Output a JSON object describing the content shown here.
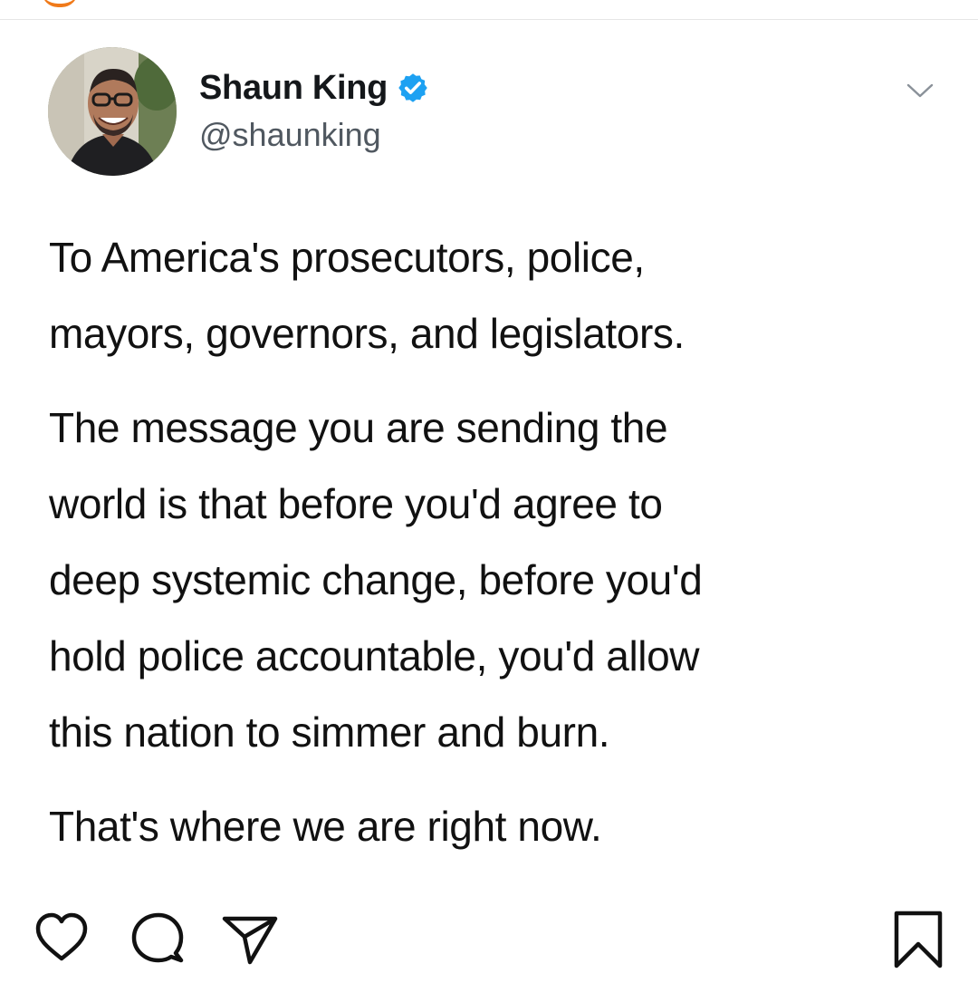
{
  "colors": {
    "accent": "#f07a1a",
    "verified": "#1da1f2",
    "text": "#111111",
    "handle": "#505860",
    "divider": "#e6e6e6"
  },
  "tweet": {
    "author_name": "Shaun King",
    "author_handle": "@shaunking",
    "verified": true,
    "paragraphs": [
      {
        "lines": [
          "To America's prosecutors, police,",
          "mayors, governors, and legislators."
        ]
      },
      {
        "lines": [
          "The message you are sending the",
          "world is that before you'd agree to",
          "deep systemic change, before you'd",
          "hold police accountable, you'd allow",
          "this nation to simmer and burn."
        ]
      },
      {
        "lines": [
          "That's where we are right now."
        ]
      }
    ]
  },
  "icons": {
    "more": "chevron-down-icon",
    "verified": "verified-badge-icon",
    "like": "heart-icon",
    "comment": "comment-icon",
    "share": "send-icon",
    "save": "bookmark-icon"
  }
}
